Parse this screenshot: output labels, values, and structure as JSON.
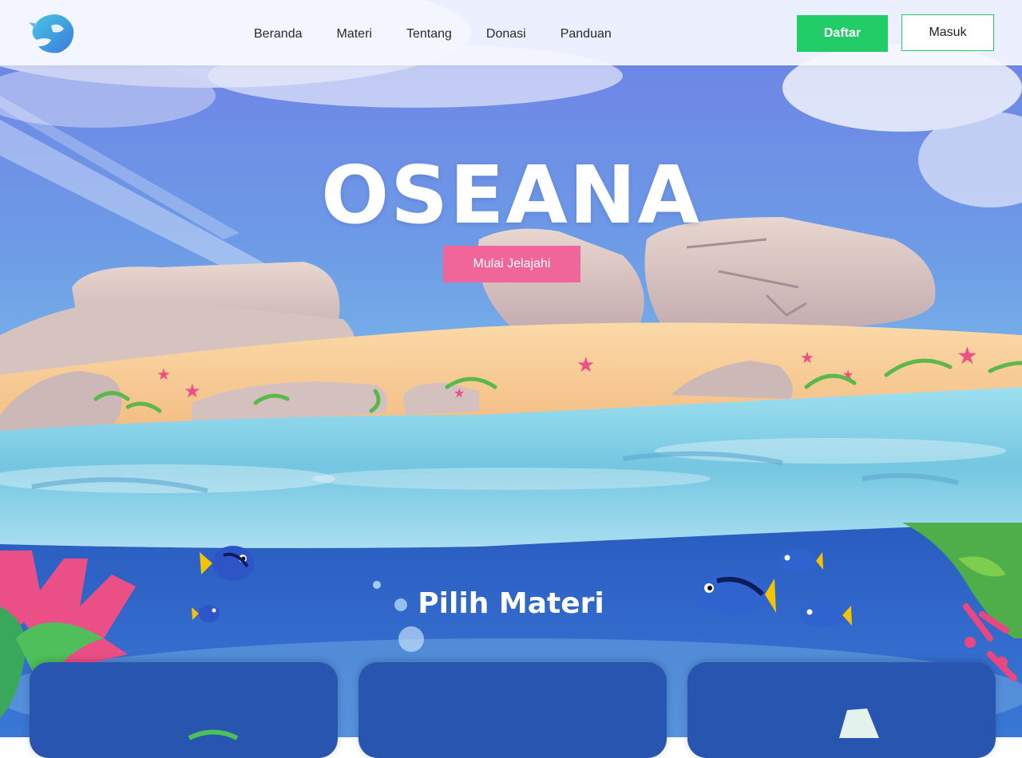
{
  "brand": {
    "logo_icon": "dolphin-logo-icon"
  },
  "nav": {
    "links": [
      "Beranda",
      "Materi",
      "Tentang",
      "Donasi",
      "Panduan"
    ],
    "daftar_label": "Daftar",
    "masuk_label": "Masuk"
  },
  "hero": {
    "title": "OSEANA",
    "cta_label": "Mulai Jelajahi"
  },
  "section": {
    "title": "Pilih Materi"
  },
  "colors": {
    "accent_green": "#22cc66",
    "accent_pink": "#f0659a",
    "ocean_blue": "#2f62c4",
    "card_blue": "#2755b0"
  }
}
